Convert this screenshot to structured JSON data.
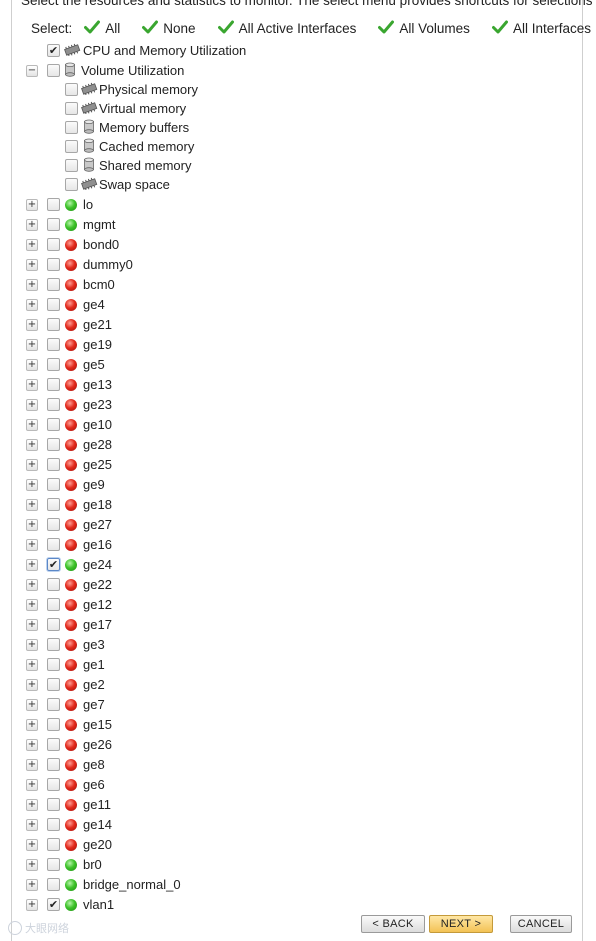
{
  "intro": "Select the resources and statistics to monitor. The select menu provides shortcuts for selections",
  "select_bar": {
    "label": "Select:",
    "options": [
      "All",
      "None",
      "All Active Interfaces",
      "All Volumes",
      "All Interfaces"
    ]
  },
  "icons": {
    "check": "checkmark-icon",
    "chip": "memory-chip-icon",
    "disk": "disk-cylinder-icon",
    "status_up": "status-green-icon",
    "status_down": "status-red-icon"
  },
  "colors": {
    "check_green": "#3aa630",
    "status_up": "#3dc22a",
    "status_down": "#e22a1d",
    "next_button": "#f3c255"
  },
  "tree": {
    "cpu": {
      "label": "CPU and Memory Utilization",
      "checked": true
    },
    "volume": {
      "label": "Volume Utilization",
      "expanded": true,
      "children": [
        {
          "label": "Physical memory",
          "icon": "memory-chip-icon"
        },
        {
          "label": "Virtual memory",
          "icon": "memory-chip-icon"
        },
        {
          "label": "Memory buffers",
          "icon": "disk-cylinder-icon"
        },
        {
          "label": "Cached memory",
          "icon": "disk-cylinder-icon"
        },
        {
          "label": "Shared memory",
          "icon": "disk-cylinder-icon"
        },
        {
          "label": "Swap space",
          "icon": "memory-chip-icon"
        }
      ]
    },
    "interfaces": [
      {
        "name": "lo",
        "status": "up",
        "checked": false
      },
      {
        "name": "mgmt",
        "status": "up",
        "checked": false
      },
      {
        "name": "bond0",
        "status": "down",
        "checked": false
      },
      {
        "name": "dummy0",
        "status": "down",
        "checked": false
      },
      {
        "name": "bcm0",
        "status": "down",
        "checked": false
      },
      {
        "name": "ge4",
        "status": "down",
        "checked": false
      },
      {
        "name": "ge21",
        "status": "down",
        "checked": false
      },
      {
        "name": "ge19",
        "status": "down",
        "checked": false
      },
      {
        "name": "ge5",
        "status": "down",
        "checked": false
      },
      {
        "name": "ge13",
        "status": "down",
        "checked": false
      },
      {
        "name": "ge23",
        "status": "down",
        "checked": false
      },
      {
        "name": "ge10",
        "status": "down",
        "checked": false
      },
      {
        "name": "ge28",
        "status": "down",
        "checked": false
      },
      {
        "name": "ge25",
        "status": "down",
        "checked": false
      },
      {
        "name": "ge9",
        "status": "down",
        "checked": false
      },
      {
        "name": "ge18",
        "status": "down",
        "checked": false
      },
      {
        "name": "ge27",
        "status": "down",
        "checked": false
      },
      {
        "name": "ge16",
        "status": "down",
        "checked": false
      },
      {
        "name": "ge24",
        "status": "up",
        "checked": true,
        "highlighted": true
      },
      {
        "name": "ge22",
        "status": "down",
        "checked": false
      },
      {
        "name": "ge12",
        "status": "down",
        "checked": false
      },
      {
        "name": "ge17",
        "status": "down",
        "checked": false
      },
      {
        "name": "ge3",
        "status": "down",
        "checked": false
      },
      {
        "name": "ge1",
        "status": "down",
        "checked": false
      },
      {
        "name": "ge2",
        "status": "down",
        "checked": false
      },
      {
        "name": "ge7",
        "status": "down",
        "checked": false
      },
      {
        "name": "ge15",
        "status": "down",
        "checked": false
      },
      {
        "name": "ge26",
        "status": "down",
        "checked": false
      },
      {
        "name": "ge8",
        "status": "down",
        "checked": false
      },
      {
        "name": "ge6",
        "status": "down",
        "checked": false
      },
      {
        "name": "ge11",
        "status": "down",
        "checked": false
      },
      {
        "name": "ge14",
        "status": "down",
        "checked": false
      },
      {
        "name": "ge20",
        "status": "down",
        "checked": false
      },
      {
        "name": "br0",
        "status": "up",
        "checked": false
      },
      {
        "name": "bridge_normal_0",
        "status": "up",
        "checked": false
      },
      {
        "name": "vlan1",
        "status": "up",
        "checked": true
      }
    ]
  },
  "buttons": {
    "back": "< BACK",
    "next": "NEXT >",
    "cancel": "CANCEL"
  },
  "watermark": "大眼网络"
}
